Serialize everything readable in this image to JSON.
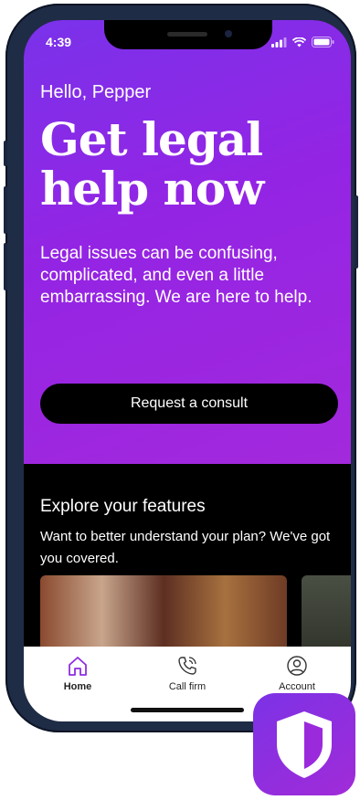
{
  "status_bar": {
    "time": "4:39"
  },
  "greeting": "Hello, Pepper",
  "headline": "Get legal\nhelp now",
  "intro": "Legal issues can be confusing, complicated, and even a little embarrassing. We are here to help.",
  "cta_label": "Request a consult",
  "features": {
    "title": "Explore your features",
    "subtitle": "Want to better understand your plan? We've got you covered."
  },
  "tabs": [
    {
      "label": "Home",
      "icon": "home-icon",
      "active": true
    },
    {
      "label": "Call firm",
      "icon": "phone-icon",
      "active": false
    },
    {
      "label": "Account",
      "icon": "account-icon",
      "active": false
    }
  ],
  "colors": {
    "accent": "#8e2de2",
    "hero_start": "#7a32ea",
    "hero_end": "#a329dc"
  }
}
